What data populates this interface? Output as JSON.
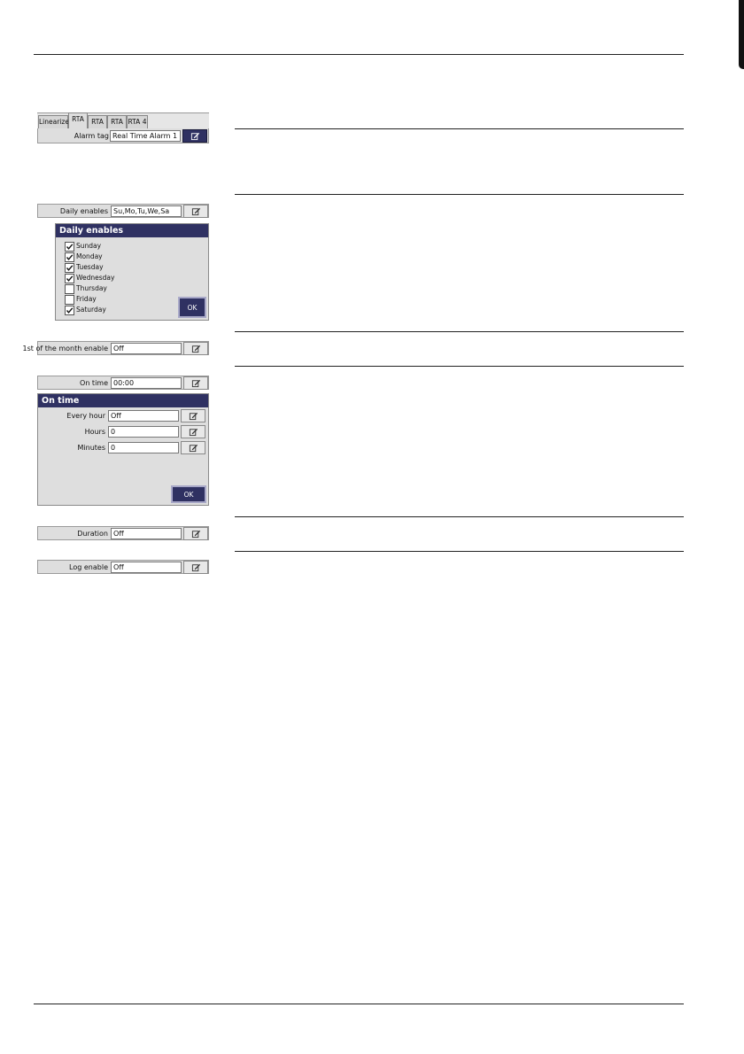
{
  "tabs": [
    {
      "label": "Linearizer",
      "active": false
    },
    {
      "label": "RTA 1",
      "active": true
    },
    {
      "label": "RTA 2",
      "active": false
    },
    {
      "label": "RTA 3",
      "active": false
    },
    {
      "label": "RTA 4",
      "active": false
    }
  ],
  "alarm_tag": {
    "label": "Alarm tag",
    "value": "Real Time Alarm 1"
  },
  "daily_enables": {
    "label": "Daily enables",
    "value": "Su,Mo,Tu,We,Sa"
  },
  "daily_dialog": {
    "title": "Daily enables",
    "days": [
      {
        "label": "Sunday",
        "checked": true
      },
      {
        "label": "Monday",
        "checked": true
      },
      {
        "label": "Tuesday",
        "checked": true
      },
      {
        "label": "Wednesday",
        "checked": true
      },
      {
        "label": "Thursday",
        "checked": false
      },
      {
        "label": "Friday",
        "checked": false
      },
      {
        "label": "Saturday",
        "checked": true
      }
    ],
    "ok_label": "OK"
  },
  "first_of_month": {
    "label": "1st of the month enable",
    "value": "Off"
  },
  "on_time": {
    "label": "On time",
    "value": "00:00"
  },
  "on_time_dialog": {
    "title": "On time",
    "every_hour": {
      "label": "Every hour",
      "value": "Off"
    },
    "hours": {
      "label": "Hours",
      "value": "0"
    },
    "minutes": {
      "label": "Minutes",
      "value": "0"
    },
    "ok_label": "OK"
  },
  "duration": {
    "label": "Duration",
    "value": "Off"
  },
  "log_enable": {
    "label": "Log enable",
    "value": "Off"
  },
  "colors": {
    "title_bar": "#2f3162",
    "panel": "#dedede"
  }
}
